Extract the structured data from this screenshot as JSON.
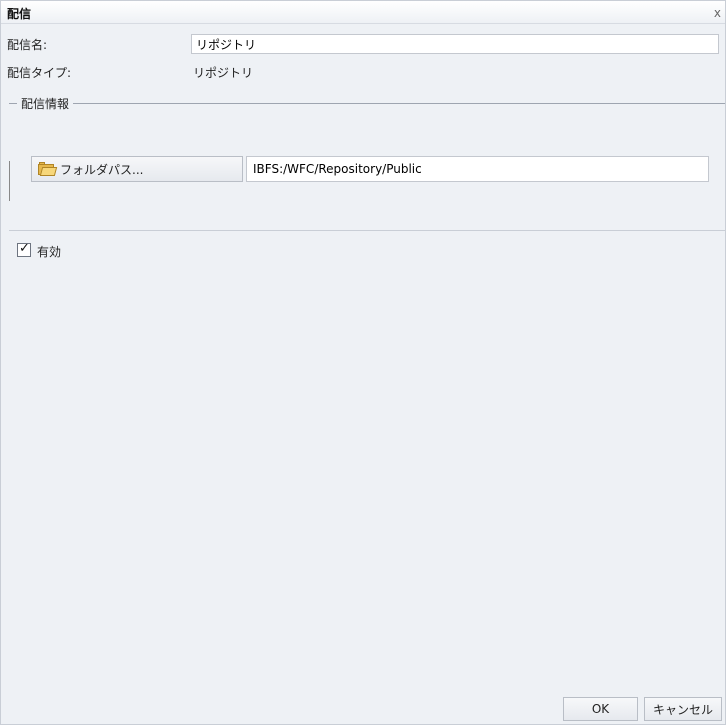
{
  "dialog": {
    "title": "配信",
    "close_glyph": "x"
  },
  "form": {
    "name_label": "配信名:",
    "name_value": "リポジトリ",
    "type_label": "配信タイプ:",
    "type_value": "リポジトリ"
  },
  "info_group": {
    "legend": "配信情報",
    "folder_button_label": "フォルダパス...",
    "folder_icon": "folder-icon",
    "path_value": "IBFS:/WFC/Repository/Public"
  },
  "enabled": {
    "label": "有効",
    "checked": true
  },
  "buttons": {
    "ok": "OK",
    "cancel": "キャンセル"
  }
}
